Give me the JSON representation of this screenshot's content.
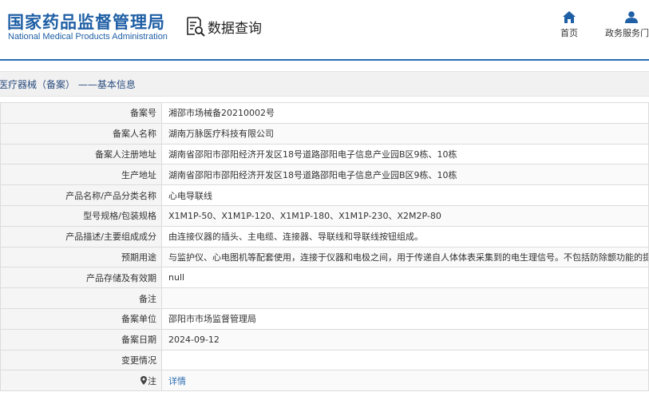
{
  "header": {
    "logo_cn": "国家药品监督管理局",
    "logo_en": "National Medical Products Administration",
    "query_label": "数据查询",
    "nav": [
      {
        "label": "首页",
        "icon": "home-icon"
      },
      {
        "label": "政务服务门户",
        "icon": "user-icon"
      }
    ]
  },
  "title": "医疗器械（备案） ——基本信息",
  "rows": [
    {
      "label": "备案号",
      "value": "湘邵市场械备20210002号"
    },
    {
      "label": "备案人名称",
      "value": "湖南万脉医疗科技有限公司"
    },
    {
      "label": "备案人注册地址",
      "value": "湖南省邵阳市邵阳经济开发区18号道路邵阳电子信息产业园B区9栋、10栋"
    },
    {
      "label": "生产地址",
      "value": "湖南省邵阳市邵阳经济开发区18号道路邵阳电子信息产业园B区9栋、10栋"
    },
    {
      "label": "产品名称/产品分类名称",
      "value": "心电导联线"
    },
    {
      "label": "型号规格/包装规格",
      "value": "X1M1P-50、X1M1P-120、X1M1P-180、X1M1P-230、X2M2P-80"
    },
    {
      "label": "产品描述/主要组成成分",
      "value": "由连接仪器的插头、主电缆、连接器、导联线和导联线按钮组成。"
    },
    {
      "label": "预期用途",
      "value": "与监护仪、心电图机等配套使用，连接于仪器和电极之间，用于传递自人体体表采集到的电生理信号。不包括防除颤功能的提供。"
    },
    {
      "label": "产品存储及有效期",
      "value": "null"
    },
    {
      "label": "备注",
      "value": ""
    },
    {
      "label": "备案单位",
      "value": "邵阳市市场监督管理局"
    },
    {
      "label": "备案日期",
      "value": "2024-09-12"
    },
    {
      "label": "变更情况",
      "value": ""
    },
    {
      "label": "注",
      "value": "详情",
      "icon": "pin-icon"
    }
  ],
  "colors": {
    "brand": "#1f5fa5",
    "rule": "#2b6db3",
    "title_text": "#2a4d7f"
  }
}
